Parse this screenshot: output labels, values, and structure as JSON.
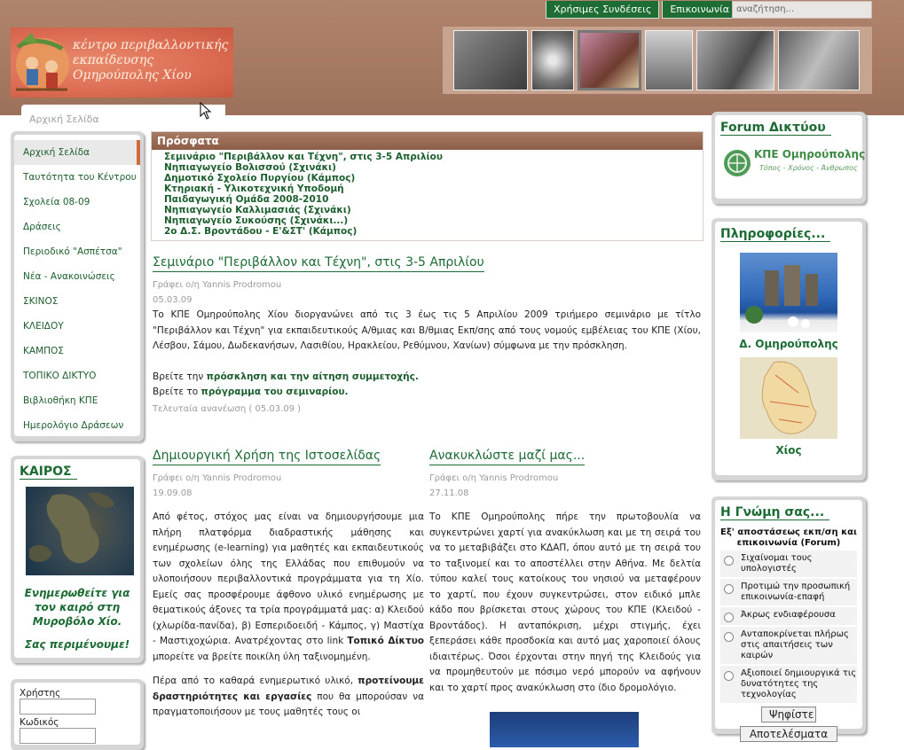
{
  "header": {
    "nav": [
      "Χρήσιμες Συνδέσεις",
      "Επικοινωνία"
    ],
    "search_placeholder": "αναζήτηση...",
    "logo_lines": [
      "κέντρο περιβαλλοντικής",
      "εκπαίδευσης",
      "Ομηρούπολης Χίου"
    ]
  },
  "breadcrumb": "Αρχική Σελίδα",
  "sidebar": {
    "items": [
      "Αρχική Σελίδα",
      "Ταυτότητα του Κέντρου",
      "Σχολεία 08-09",
      "Δράσεις",
      "Περιοδικό \"Ασπέτσα\"",
      "Νέα - Ανακοινώσεις",
      "ΣΚΙΝΟΣ",
      "ΚΛΕΙΔΟΥ",
      "ΚΑΜΠΟΣ",
      "ΤΟΠΙΚΟ ΔΙΚΤΥΟ",
      "Βιβλιοθήκη ΚΠΕ",
      "Ημερολόγιο Δράσεων"
    ],
    "active_index": 0
  },
  "weather": {
    "title": "ΚΑΙΡΟΣ",
    "message": "Ενημερωθείτε για τον καιρό στη Μυροβόλο Χίο.",
    "sub": "Σας περιμένουμε!"
  },
  "login": {
    "user_label": "Χρήστης",
    "pass_label": "Κωδικός"
  },
  "recent": {
    "title": "Πρόσφατα",
    "items": [
      "Σεμινάριο \"Περιβάλλον και Τέχνη\", στις 3-5 Απριλίου",
      "Νηπιαγωγείο Βολισσού (Σχινάκι)",
      "Δημοτικό Σχολείο Πυργίου (Κάμπος)",
      "Κτηριακή - Υλικοτεχνική Υποδομή",
      "Παιδαγωγική Ομάδα 2008-2010",
      "Νηπιαγωγείο Καλλιμασιάς (Σχινάκι)",
      "Νηπιαγωγείο Συκούσης (Σχινάκι...)",
      "2ο Δ.Σ. Βροντάδου - Ε'&ΣΤ' (Κάμπος)"
    ]
  },
  "article_main": {
    "title": "Σεμινάριο \"Περιβάλλον και Τέχνη\", στις 3-5 Απριλίου",
    "author": "Γράφει ο/η Yannis Prodromou",
    "date": "05.03.09",
    "body": "Το ΚΠΕ Ομηρούπολης Χίου διοργανώνει από τις 3 έως τις 5 Απριλίου 2009 τριήμερο σεμινάριο με τίτλο \"Περιβάλλον και Τέχνη\" για εκπαιδευτικούς Α/θμιας και Β/θμιας Εκπ/σης από τους νομούς εμβέλειας του ΚΠΕ (Χίου, Λέσβου, Σάμου, Δωδεκανήσων, Λασιθίου, Ηρακλείου, Ρεθύμνου, Χανίων) σύμφωνα με την πρόσκληση.",
    "line1_pre": "Βρείτε την",
    "line1_link": "πρόσκληση και την αίτηση συμμετοχής.",
    "line2_pre": "Βρείτε το",
    "line2_link": "πρόγραμμα του σεμιναρίου.",
    "updated": "Τελευταία ανανέωση ( 05.03.09 )"
  },
  "article_left": {
    "title": "Δημιουργική Χρήση της Ιστοσελίδας",
    "author": "Γράφει ο/η Yannis Prodromou",
    "date": "19.09.08",
    "p1_a": "Από φέτος, στόχος μας είναι να δημιουργήσουμε μια πλήρη πλατφόρμα διαδραστικής μάθησης και ενημέρωσης (e-learning) για μαθητές και εκπαιδευτικούς των σχολείων όλης της Ελλάδας που επιθυμούν να υλοποιήσουν περιβαλλοντικά προγράμματα για τη Χίο. Εμείς σας προσφέρουμε άφθονο υλικό ενημέρωσης με θεματικούς άξονες τα τρία προγράμματά μας: α) Κλειδού (χλωρίδα-πανίδα), β) Εσπεριδοειδή - Κάμπος, γ) Μαστίχα - Μαστιχοχώρια. Ανατρέχοντας στο link",
    "p1_bold": "Τοπικό Δίκτυο",
    "p1_b": "μπορείτε να βρείτε ποικίλη ύλη ταξινομημένη.",
    "p2_a": "Πέρα από το καθαρά ενημερωτικό υλικό,",
    "p2_bold": "προτείνουμε δραστηριότητες και εργασίες",
    "p2_b": "που θα μπορούσαν να πραγματοποιήσουν με τους μαθητές τους οι"
  },
  "article_right": {
    "title": "Ανακυκλώστε μαζί μας...",
    "author": "Γράφει ο/η Yannis Prodromou",
    "date": "27.11.08",
    "body": "Το ΚΠΕ Ομηρούπολης πήρε την πρωτοβουλία να συγκεντρώνει χαρτί για ανακύκλωση και με τη σειρά του να το μεταβιβάζει στο ΚΔΑΠ, όπου αυτό με τη σειρά του το ταξινομεί και το αποστέλλει στην Αθήνα. Με δελτία τύπου καλεί τους κατοίκους του νησιού να μεταφέρουν το χαρτί, που έχουν συγκεντρώσει, στον ειδικό μπλε κάδο που βρίσκεται στους χώρους του ΚΠΕ (Κλειδού - Βροντάδος). Η ανταπόκριση, μέχρι στιγμής, έχει ξεπεράσει κάθε προσδοκία και αυτό μας χαροποιεί όλους ιδιαιτέρως. Όσοι έρχονται στην πηγή της Κλειδούς για να προμηθευτούν με πόσιμο νερό μπορούν να αφήνουν και το χαρτί προς ανακύκλωση στο ίδιο δρομολόγιο."
  },
  "forum": {
    "title": "Forum Δικτύου",
    "logo_text": "ΚΠΕ Ομηρούπολης",
    "logo_sub": "Τόπος - Χρόνος - Άνθρωπος"
  },
  "info": {
    "title": "Πληροφορίες...",
    "caption1": "Δ. Ομηρούπολης",
    "caption2": "Χίος"
  },
  "poll": {
    "title": "Η Γνώμη σας...",
    "question": "Εξ' αποστάσεως εκπ/ση και επικοινωνία (Forum)",
    "options": [
      "Σιχαίνομαι τους υπολογιστές",
      "Προτιμώ την προσωπική επικοινωνία-επαφή",
      "Άκρως ενδιαφέρουσα",
      "Ανταποκρίνεται πλήρως στις απαιτήσεις των καιρών",
      "Αξιοποιεί δημιουργικά τις δυνατότητες της τεχνολογίας"
    ],
    "vote_label": "Ψηφίστε",
    "results_label": "Αποτελέσματα"
  }
}
